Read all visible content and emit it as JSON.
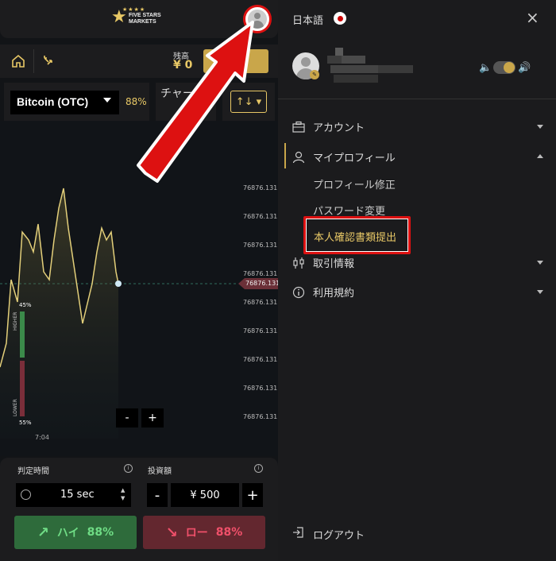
{
  "header": {
    "logo_line1": "FIVE STARS",
    "logo_line2": "MARKETS"
  },
  "navbar": {
    "balance_label": "残高",
    "balance_value": "¥ 0",
    "icons": [
      "home-icon",
      "swap-icon"
    ]
  },
  "asset": {
    "name": "Bitcoin (OTC)",
    "payout": "88%",
    "chart_label": "チャート",
    "timeframe_icon": "sort-arrows-icon"
  },
  "chart": {
    "price_labels": [
      "76876.131",
      "76876.131",
      "76876.131",
      "76876.131",
      "76876.131",
      "76876.131",
      "76876.131",
      "76876.131",
      "76876.131",
      "76876.131",
      "76876.131",
      "76876.131",
      "76876.131",
      "76876.131",
      "76876.131"
    ],
    "current_price": "76876.131",
    "higher_label": "HIGHER",
    "lower_label": "LOWER",
    "higher_pct": "45%",
    "lower_pct": "55%",
    "time_label": "7:04",
    "zoom_out": "-",
    "zoom_in": "+",
    "higher_share": 0.45,
    "lower_share": 0.55
  },
  "trade": {
    "duration_label": "判定時間",
    "amount_label": "投資額",
    "duration_value": "15 sec",
    "amount_value": "¥ 500",
    "minus": "-",
    "plus": "+",
    "high_label": "ハイ",
    "high_pct": "88%",
    "low_label": "ロー",
    "low_pct": "88%",
    "colors": {
      "high_bg": "#2e6b3b",
      "low_bg": "#63272f",
      "accent": "#c9a64a"
    }
  },
  "panel": {
    "language": "日本語",
    "close": "×",
    "menu": [
      {
        "label": "アカウント",
        "icon": "briefcase-icon"
      },
      {
        "label": "マイプロフィール",
        "icon": "user-icon"
      },
      {
        "label": "取引情報",
        "icon": "candlestick-icon"
      },
      {
        "label": "利用規約",
        "icon": "info-icon"
      }
    ],
    "submenu": [
      "プロフィール修正",
      "パスワード変更",
      "本人確認書類提出"
    ],
    "logout": "ログアウト"
  }
}
